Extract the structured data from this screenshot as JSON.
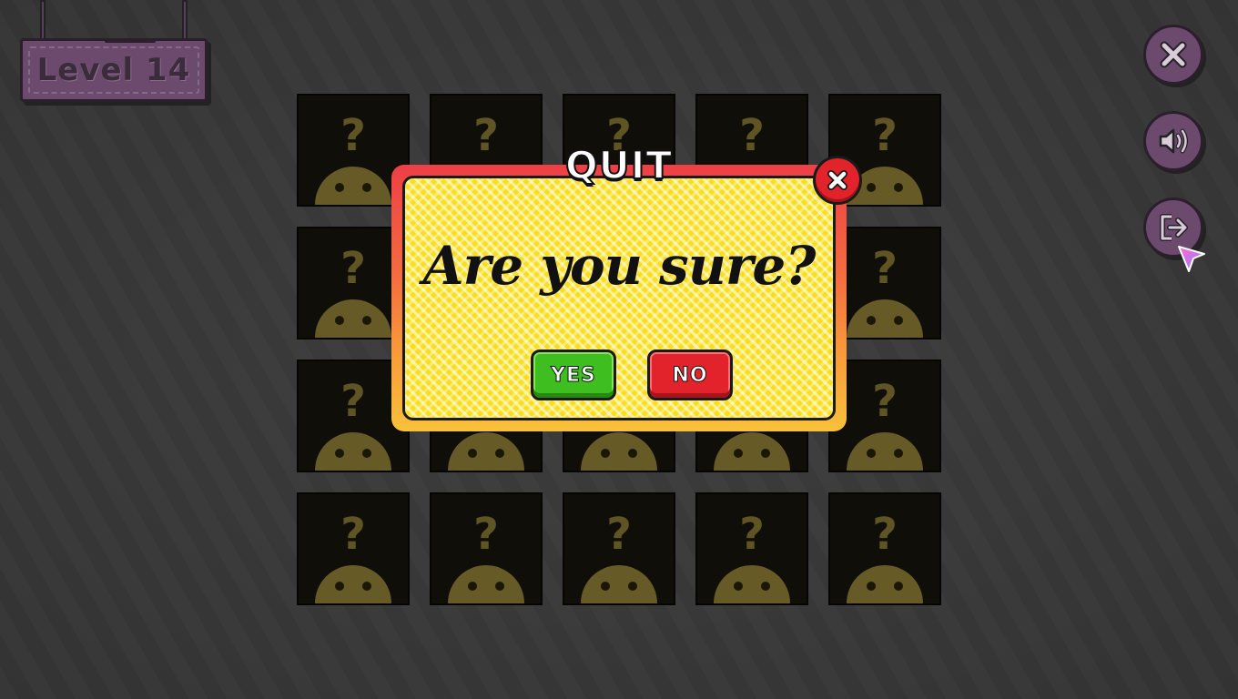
{
  "level_sign": {
    "label": "Level 14"
  },
  "side_buttons": [
    {
      "name": "close",
      "icon": "close-icon"
    },
    {
      "name": "sound",
      "icon": "speaker-icon"
    },
    {
      "name": "exit",
      "icon": "exit-icon"
    }
  ],
  "cards": {
    "rows": 4,
    "cols": 5,
    "face_text": "?"
  },
  "dialog": {
    "title": "QUIT",
    "message": "Are you sure?",
    "yes_label": "YES",
    "no_label": "NO",
    "close_icon": "close-icon"
  },
  "colors": {
    "background": "#3a3a3a",
    "sign_purple": "#6b4a6e",
    "dialog_yellow": "#f9de1f",
    "yes_green": "#3fbf1f",
    "no_red": "#e3232c",
    "card_bg": "#0f0e08",
    "card_accent": "#665a26"
  }
}
